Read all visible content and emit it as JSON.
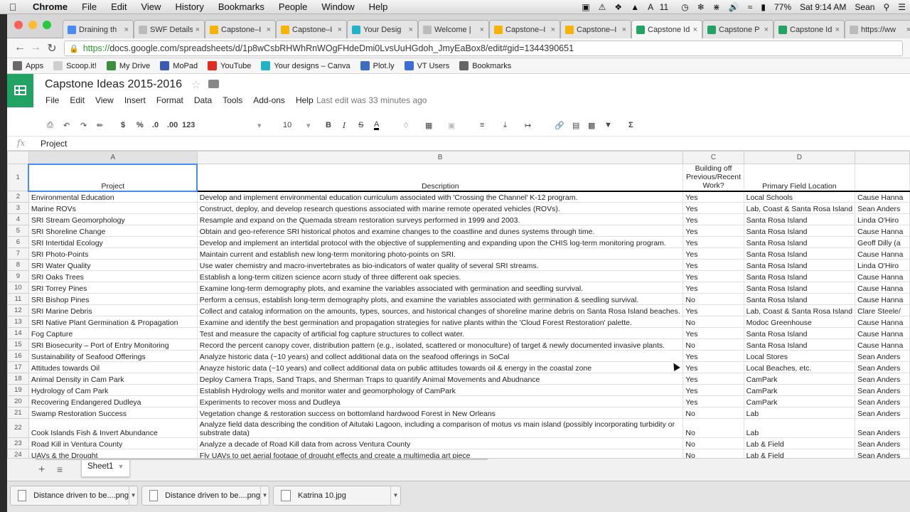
{
  "menubar": {
    "app": "Chrome",
    "items": [
      "File",
      "Edit",
      "View",
      "History",
      "Bookmarks",
      "People",
      "Window",
      "Help"
    ],
    "status": {
      "adobe_count": "11",
      "battery": "77%",
      "time": "Sat 9:14 AM",
      "user": "Sean"
    }
  },
  "tabs": [
    {
      "label": "Draining th",
      "icon": "google-icon"
    },
    {
      "label": "SWF Details",
      "icon": "page-icon"
    },
    {
      "label": "Capstone–I",
      "icon": "drive-icon"
    },
    {
      "label": "Capstone–I",
      "icon": "drive-icon"
    },
    {
      "label": "Your Desig",
      "icon": "canva-icon"
    },
    {
      "label": "Welcome |",
      "icon": "page-icon"
    },
    {
      "label": "Capstone–I",
      "icon": "drive-icon"
    },
    {
      "label": "Capstone–I",
      "icon": "drive-icon"
    },
    {
      "label": "Capstone Id",
      "icon": "sheets-icon",
      "active": true
    },
    {
      "label": "Capstone P",
      "icon": "sheets-icon"
    },
    {
      "label": "Capstone Id",
      "icon": "sheets-icon"
    },
    {
      "label": "https://ww",
      "icon": "page-icon"
    }
  ],
  "address": {
    "scheme": "https://",
    "rest": "docs.google.com/spreadsheets/d/1p8wCsbRHWhRnWOgFHdeDmi0LvsUuHGdoh_JmyEaBox8/edit#gid=1344390651"
  },
  "bookmarks": [
    {
      "label": "Apps",
      "icon": "apps-icon",
      "color": "#6a6a6a"
    },
    {
      "label": "Scoop.it!",
      "icon": "page-icon",
      "color": "#cfcfcf"
    },
    {
      "label": "My Drive",
      "icon": "drive-icon",
      "color": "#3a8f3a"
    },
    {
      "label": "MoPad",
      "icon": "mopad-icon",
      "color": "#3b5bb0"
    },
    {
      "label": "YouTube",
      "icon": "youtube-icon",
      "color": "#e02b20"
    },
    {
      "label": "Your designs – Canva",
      "icon": "canva-icon",
      "color": "#20b3c9"
    },
    {
      "label": "Plot.ly",
      "icon": "plotly-icon",
      "color": "#3d6cc0"
    },
    {
      "label": "VT Users",
      "icon": "vt-icon",
      "color": "#3f6bd8"
    },
    {
      "label": "Bookmarks",
      "icon": "star-icon",
      "color": "#666666"
    }
  ],
  "doc": {
    "title": "Capstone Ideas 2015-2016",
    "menu": [
      "File",
      "Edit",
      "View",
      "Insert",
      "Format",
      "Data",
      "Tools",
      "Add-ons",
      "Help"
    ],
    "last_edit": "Last edit was 33 minutes ago"
  },
  "toolbar": {
    "currency": "$",
    "percent": "%",
    "dec_less": ".0",
    "dec_more": ".00",
    "format_more": "123",
    "font_size": "10",
    "bold": "B",
    "italic": "I",
    "strike": "S",
    "text_color": "A",
    "sum": "Σ"
  },
  "formula": {
    "fx": "fx",
    "value": "Project"
  },
  "sheet": {
    "columns": [
      "A",
      "B",
      "C",
      "D"
    ],
    "header": {
      "row": "1",
      "a": "Project",
      "b": "Description",
      "c": "Building off Previous/Recent Work?",
      "d": "Primary Field Location"
    },
    "rows": [
      {
        "n": "2",
        "a": "Environmental Education",
        "b": "Develop and implement environmental education curriculum associated with 'Crossing the Channel' K-12 program.",
        "c": "Yes",
        "d": "Local Schools",
        "e": "Cause Hanna"
      },
      {
        "n": "3",
        "a": "Marine ROVs",
        "b": "Construct, deploy, and develop research questions associated with marine remote operated vehicles (ROVs).",
        "c": "Yes",
        "d": "Lab, Coast & Santa Rosa Island",
        "e": "Sean Anders"
      },
      {
        "n": "4",
        "a": "SRI Stream Geomorphology",
        "b": "Resample and expand on the Quemada stream restoration surveys performed in 1999 and 2003.",
        "c": "Yes",
        "d": "Santa Rosa Island",
        "e": "Linda O'Hiro"
      },
      {
        "n": "5",
        "a": "SRI Shoreline Change",
        "b": "Obtain and geo-reference SRI historical photos and examine changes to the coastline and dunes systems through time.",
        "c": "Yes",
        "d": "Santa Rosa Island",
        "e": "Cause Hanna"
      },
      {
        "n": "6",
        "a": "SRI Intertidal Ecology",
        "b": "Develop and implement an intertidal protocol with the objective of supplementing and expanding upon the CHIS log-term monitoring program.",
        "c": "Yes",
        "d": "Santa Rosa Island",
        "e": "Geoff Dilly (a"
      },
      {
        "n": "7",
        "a": "SRI Photo-Points",
        "b": "Maintain current and establish new long-term monitoring photo-points on SRI.",
        "c": "Yes",
        "d": "Santa Rosa Island",
        "e": "Cause Hanna"
      },
      {
        "n": "8",
        "a": "SRI Water Quality",
        "b": "Use water chemistry and macro-invertebrates as bio-indicators of water quality of several SRI streams.",
        "c": "Yes",
        "d": "Santa Rosa Island",
        "e": "Linda O'Hiro"
      },
      {
        "n": "9",
        "a": "SRI Oaks Trees",
        "b": "Establish a long-term citizen science acorn study of three different oak species.",
        "c": "Yes",
        "d": "Santa Rosa Island",
        "e": "Cause Hanna"
      },
      {
        "n": "10",
        "a": "SRI Torrey Pines",
        "b": "Examine long-term demography plots, and examine the variables associated with germination and seedling survival.",
        "c": "Yes",
        "d": "Santa Rosa Island",
        "e": "Cause Hanna"
      },
      {
        "n": "11",
        "a": "SRI Bishop Pines",
        "b": "Perform a census, establish long-term demography plots, and examine the variables associated with germination & seedling survival.",
        "c": "No",
        "d": "Santa Rosa Island",
        "e": "Cause Hanna"
      },
      {
        "n": "12",
        "a": "SRI Marine Debris",
        "b": "Collect and catalog information on the amounts, types, sources, and historical changes of shoreline marine debris on Santa Rosa Island beaches.",
        "c": "Yes",
        "d": "Lab, Coast & Santa Rosa Island",
        "e": "Clare Steele/"
      },
      {
        "n": "13",
        "a": "SRI Native Plant Germination & Propagation",
        "b": "Examine and identify the best germination and propagation strategies for native plants within the 'Cloud Forest Restoration' palette.",
        "c": "No",
        "d": "Modoc Greenhouse",
        "e": "Cause Hanna"
      },
      {
        "n": "14",
        "a": "Fog Capture",
        "b": "Test and measure the capacity of artificial fog capture structures to collect water.",
        "c": "Yes",
        "d": "Santa Rosa Island",
        "e": "Cause Hanna"
      },
      {
        "n": "15",
        "a": "SRI Biosecurity – Port of Entry Monitoring",
        "b": "Record the percent canopy cover, distribution pattern (e.g., isolated, scattered or monoculture) of target & newly documented invasive plants.",
        "c": "No",
        "d": "Santa Rosa Island",
        "e": "Cause Hanna"
      },
      {
        "n": "16",
        "a": "Sustainability of Seafood Offerings",
        "b": "Analyze historic data (~10 years) and collect additional data on the seafood offerings in SoCal",
        "c": "Yes",
        "d": "Local Stores",
        "e": "Sean Anders"
      },
      {
        "n": "17",
        "a": "Attitudes towards Oil",
        "b": "Anayze historic data (~10 years) and collect additional data on public attitudes towards oil & energy in the coastal zone",
        "c": "Yes",
        "d": "Local Beaches, etc.",
        "e": "Sean Anders"
      },
      {
        "n": "18",
        "a": "Animal Density in Cam Park",
        "b": "Deploy Camera Traps, Sand Traps, and Sherman Traps to quantify Animal Movements and Abudnance",
        "c": "Yes",
        "d": "CamPark",
        "e": "Sean Anders"
      },
      {
        "n": "19",
        "a": "Hydrology of Cam Park",
        "b": "Establish Hydrology wells and monitor water and geomorphology of CamPark",
        "c": "Yes",
        "d": "CamPark",
        "e": "Sean Anders"
      },
      {
        "n": "20",
        "a": "Recovering Endangered Dudleya",
        "b": "Experiments to recover moss and Dudleya",
        "c": "Yes",
        "d": "CamPark",
        "e": "Sean Anders"
      },
      {
        "n": "21",
        "a": "Swamp Restoration Success",
        "b": "Vegetation change & restoration success on bottomland hardwood Forest in New Orleans",
        "c": "No",
        "d": "Lab",
        "e": "Sean Anders"
      },
      {
        "n": "22",
        "a": "Cook Islands Fish & Invert Abundance",
        "b": "Analyze field data describing the condition of Aitutaki Lagoon, including a comparison of motus vs main island (possibly incorporating turbidity or substrate data)",
        "c": "No",
        "d": "Lab",
        "e": "Sean Anders",
        "tall": true
      },
      {
        "n": "23",
        "a": "Road Kill in Ventura County",
        "b": "Analyze a decade of Road Kill data from across Ventura County",
        "c": "No",
        "d": "Lab & Field",
        "e": "Sean Anders"
      },
      {
        "n": "24",
        "a": "UAVs & the Drought",
        "b": "Fly UAVs to get aerial footage of drought effects and create a multimedia art piece",
        "c": "No",
        "d": "Lab & Field",
        "e": "Sean Anders"
      }
    ]
  },
  "sheet_tab": "Sheet1",
  "downloads": [
    "Distance driven to be....png",
    "Distance driven to be....png",
    "Katrina 10.jpg"
  ]
}
